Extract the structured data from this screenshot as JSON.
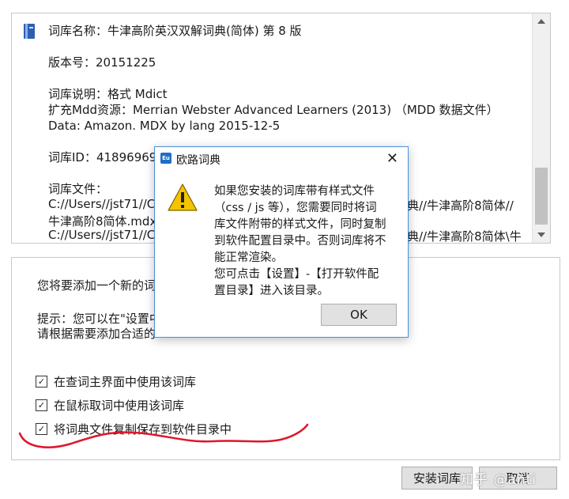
{
  "info": {
    "lines": [
      "词库名称：牛津高阶英汉双解词典(简体) 第 8 版",
      "",
      "版本号：20151225",
      "",
      "词库说明：格式 Mdict",
      "扩充Mdd资源：Merrian Webster Advanced Learners (2013) （MDD 数据文件）",
      "Data: Amazon. MDX by lang 2015-12-5",
      "",
      "词库ID：41896969",
      "",
      "词库文件：",
      "C://Users//jst71//C",
      "牛津高阶8简体.mdx",
      "C://Users//jst71//C"
    ],
    "tail_right_1": "典//牛津高阶8简体//",
    "tail_right_2": "典//牛津高阶8简体\\牛"
  },
  "add": {
    "intro": "您将要添加一个新的词",
    "tip1": "提示：您可以在\"设置中",
    "tip2": "请根据需要添加合适的"
  },
  "options": [
    {
      "label": "在查词主界面中使用该词库",
      "checked": true
    },
    {
      "label": "在鼠标取词中使用该词库",
      "checked": true
    },
    {
      "label": "将词典文件复制保存到软件目录中",
      "checked": true
    }
  ],
  "buttons": {
    "install": "安装词库",
    "cancel": "取消"
  },
  "watermark": "知乎 @anti",
  "dialog": {
    "title": "欧路词典",
    "message_lines": [
      "如果您安装的词库带有样式文件",
      "（css / js 等），您需要同时将词",
      "库文件附带的样式文件，同时复制",
      "到软件配置目录中。否则词库将不",
      "能正常渲染。",
      "您可点击【设置】-【打开软件配",
      "置目录】进入该目录。"
    ],
    "ok": "OK"
  },
  "colors": {
    "accent": "#1f6fc6",
    "annotation": "#e0162b",
    "warning": "#f5c400"
  }
}
